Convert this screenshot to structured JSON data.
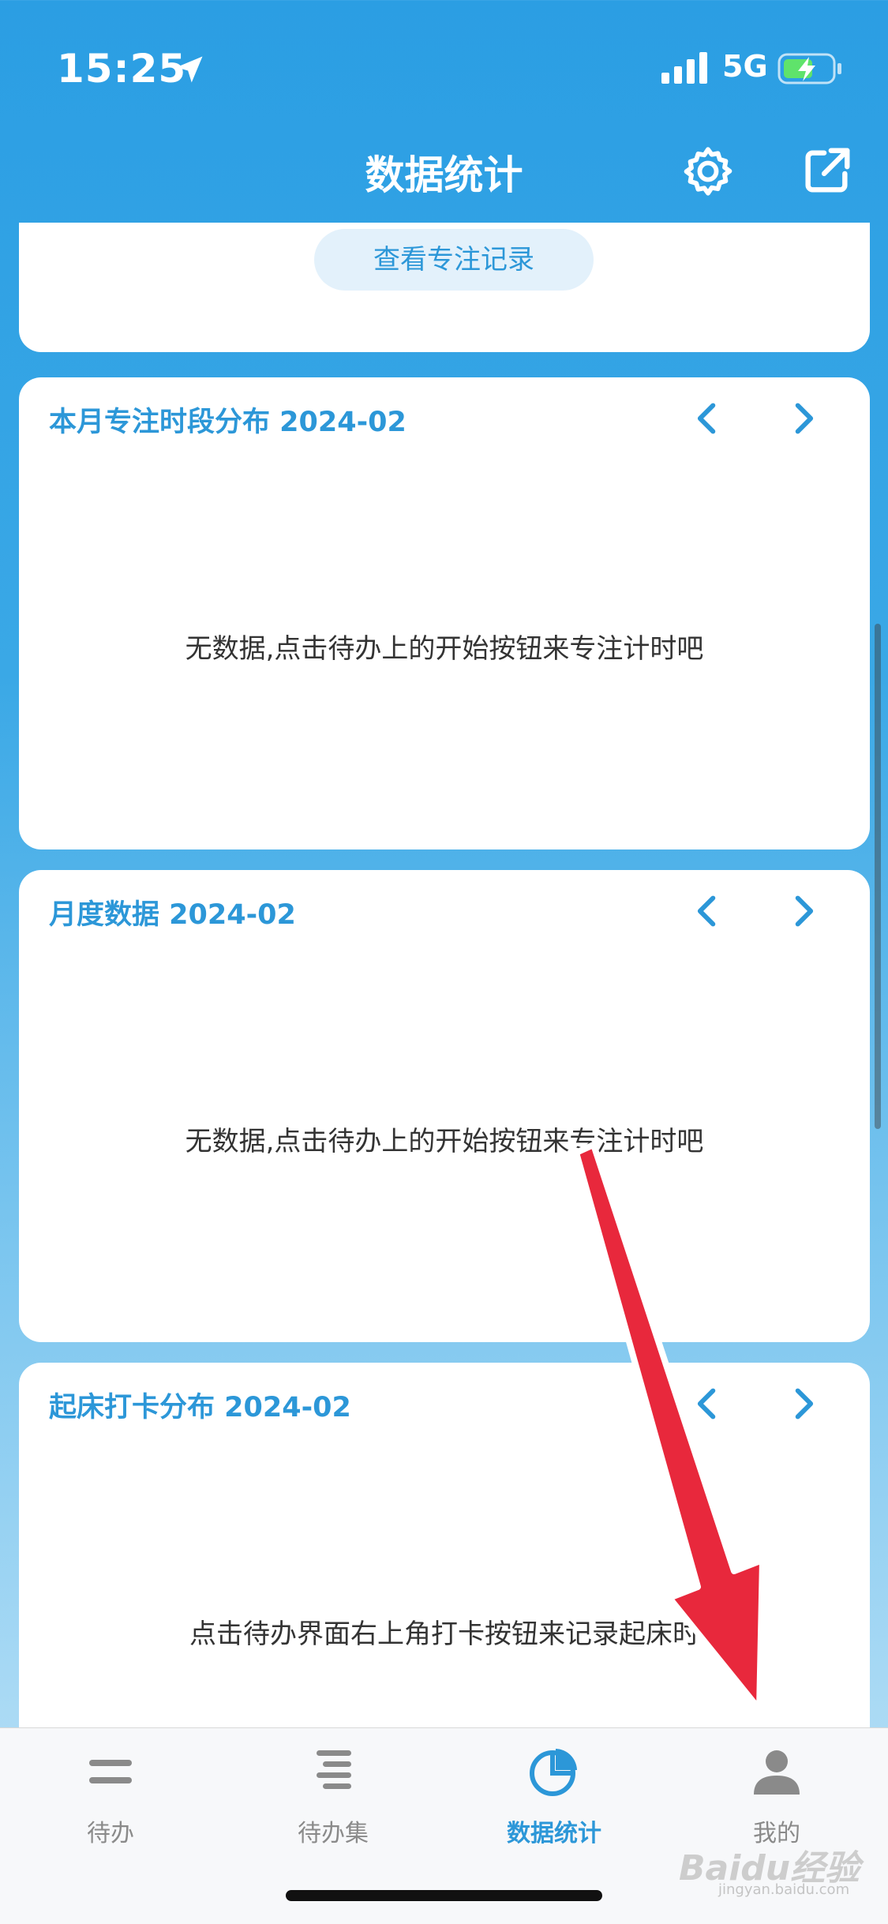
{
  "status_bar": {
    "time": "15:25",
    "network": "5G"
  },
  "nav": {
    "title": "数据统计"
  },
  "top_card": {
    "button_label": "查看专注记录"
  },
  "cards": [
    {
      "title": "本月专注时段分布  2024-02",
      "empty_text": "无数据,点击待办上的开始按钮来专注计时吧"
    },
    {
      "title": "月度数据 2024-02",
      "empty_text": "无数据,点击待办上的开始按钮来专注计时吧"
    },
    {
      "title": "起床打卡分布 2024-02",
      "empty_text": "点击待办界面右上角打卡按钮来记录起床时"
    }
  ],
  "tabs": [
    {
      "label": "待办",
      "icon": "list-icon"
    },
    {
      "label": "待办集",
      "icon": "list-collection-icon"
    },
    {
      "label": "数据统计",
      "icon": "pie-chart-icon",
      "active": true
    },
    {
      "label": "我的",
      "icon": "person-icon"
    }
  ],
  "watermark": {
    "text": "Baidu经验",
    "sub": "jingyan.baidu.com"
  },
  "colors": {
    "accent": "#2c97d8",
    "header_blue": "#2b9ee3",
    "arrow_red": "#e8283c"
  }
}
